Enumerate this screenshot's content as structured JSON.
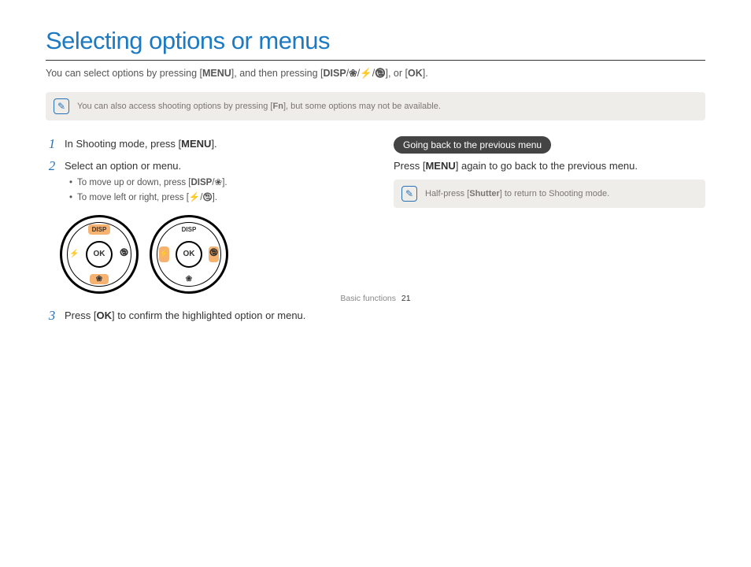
{
  "title": "Selecting options or menus",
  "intro": {
    "t1": "You can select options by pressing [",
    "k1": "MENU",
    "t2": "], and then pressing [",
    "k2": "DISP",
    "t3": "/",
    "g1": "❀",
    "t4": "/",
    "g2": "⚡",
    "t5": "/",
    "g3": "🕲",
    "t6": "], or [",
    "k3": "OK",
    "t7": "]."
  },
  "note1": {
    "t1": "You can also access shooting options by pressing [",
    "k1": "Fn",
    "t2": "], but some options may not be available."
  },
  "steps": {
    "s1": {
      "num": "1",
      "t1": "In Shooting mode, press [",
      "k1": "MENU",
      "t2": "]."
    },
    "s2": {
      "num": "2",
      "t1": "Select an option or menu.",
      "b1": {
        "t1": "To move up or down, press [",
        "k1": "DISP",
        "t2": "/",
        "g1": "❀",
        "t3": "]."
      },
      "b2": {
        "t1": "To move left or right, press [",
        "g1": "⚡",
        "t2": "/",
        "g2": "🕲",
        "t3": "]."
      }
    },
    "s3": {
      "num": "3",
      "t1": "Press [",
      "k1": "OK",
      "t2": "] to confirm the highlighted option or menu."
    }
  },
  "dial_labels": {
    "disp": "DISP",
    "ok": "OK",
    "flower": "❀",
    "flash": "⚡",
    "timer": "🕲"
  },
  "right": {
    "pill": "Going back to the previous menu",
    "text": {
      "t1": "Press [",
      "k1": "MENU",
      "t2": "] again to go back to the previous menu."
    },
    "note": {
      "t1": "Half-press [",
      "k1": "Shutter",
      "t2": "] to return to Shooting mode."
    }
  },
  "footer": {
    "section": "Basic functions",
    "page": "21"
  }
}
